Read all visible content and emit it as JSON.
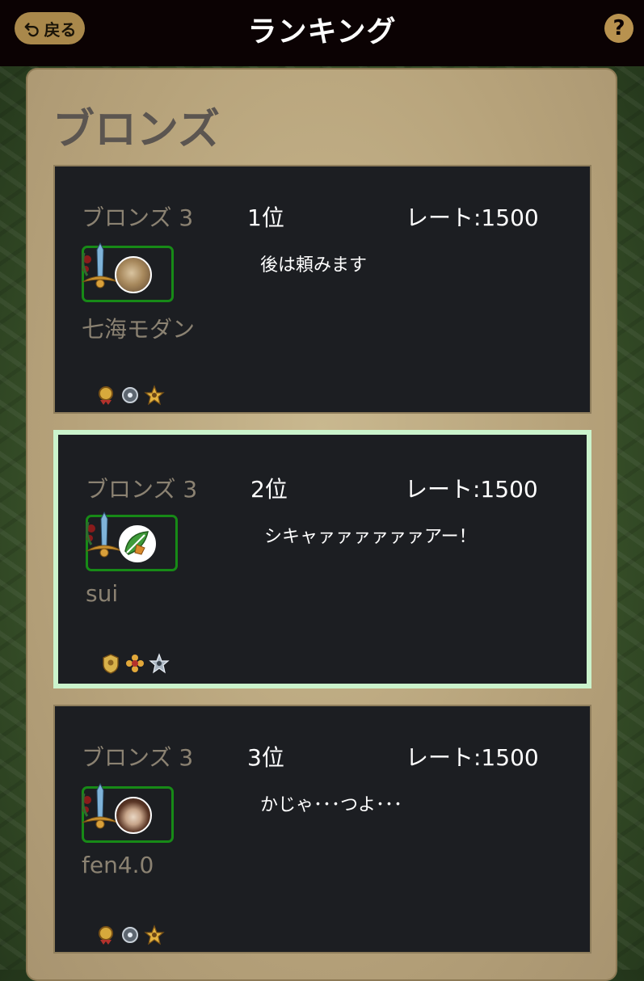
{
  "header": {
    "back_label": "戻る",
    "title": "ランキング",
    "help_label": "?"
  },
  "tier_title": "ブロンズ",
  "entries": [
    {
      "rank_name": "ブロンズ 3",
      "position": "1位",
      "rate": "レート:1500",
      "comment": "後は頼みます",
      "player": "七海モダン",
      "avatar_icon": "hamster-avatar",
      "badges": [
        "gold-medal-badge",
        "silver-orb-badge",
        "gold-star-badge"
      ],
      "selected": false
    },
    {
      "rank_name": "ブロンズ 3",
      "position": "2位",
      "rate": "レート:1500",
      "comment": "シキャァァァァァァアー！",
      "player": "sui",
      "avatar_icon": "leaf-emblem-avatar",
      "badges": [
        "gold-crest-badge",
        "gold-flower-badge",
        "silver-star-badge"
      ],
      "selected": true
    },
    {
      "rank_name": "ブロンズ 3",
      "position": "3位",
      "rate": "レート:1500",
      "comment": "かじゃ･･･つよ･･･",
      "player": "fen4.0",
      "avatar_icon": "anime-face-avatar",
      "badges": [
        "gold-medal-badge",
        "silver-orb-badge",
        "gold-star-badge"
      ],
      "selected": false
    }
  ],
  "colors": {
    "header_bg": "#0b0203",
    "accent_gold": "#a9884b",
    "card_bg": "#1c1e22",
    "selected_border": "#cbf3cc",
    "frame_green": "#178a17"
  }
}
